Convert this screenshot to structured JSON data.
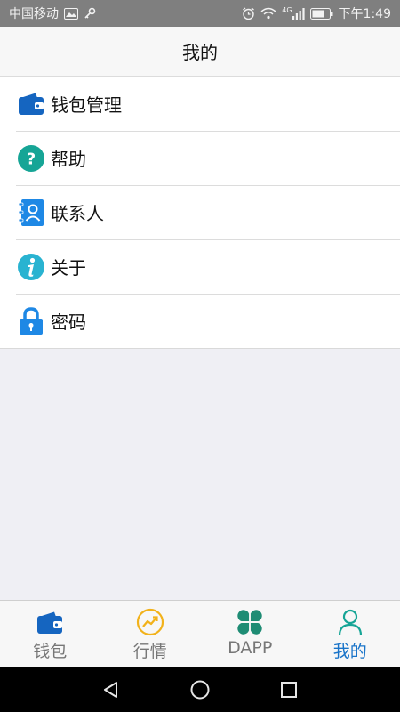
{
  "status_bar": {
    "carrier": "中国移动",
    "network": "4G",
    "time": "下午1:49"
  },
  "header": {
    "title": "我的"
  },
  "menu": {
    "items": [
      {
        "label": "钱包管理",
        "icon": "wallet-icon"
      },
      {
        "label": "帮助",
        "icon": "help-icon"
      },
      {
        "label": "联系人",
        "icon": "contacts-icon"
      },
      {
        "label": "关于",
        "icon": "info-icon"
      },
      {
        "label": "密码",
        "icon": "lock-icon"
      }
    ]
  },
  "tabbar": {
    "active_index": 3,
    "tabs": [
      {
        "label": "钱包",
        "icon": "wallet-icon"
      },
      {
        "label": "行情",
        "icon": "chart-trend-icon"
      },
      {
        "label": "DAPP",
        "icon": "clover-icon"
      },
      {
        "label": "我的",
        "icon": "user-icon"
      }
    ]
  },
  "colors": {
    "accent": "#1a74c9",
    "teal": "#16a596",
    "wallet_blue": "#1565c0",
    "chart_yellow": "#f2b21b",
    "dapp_green": "#1e8c74"
  }
}
